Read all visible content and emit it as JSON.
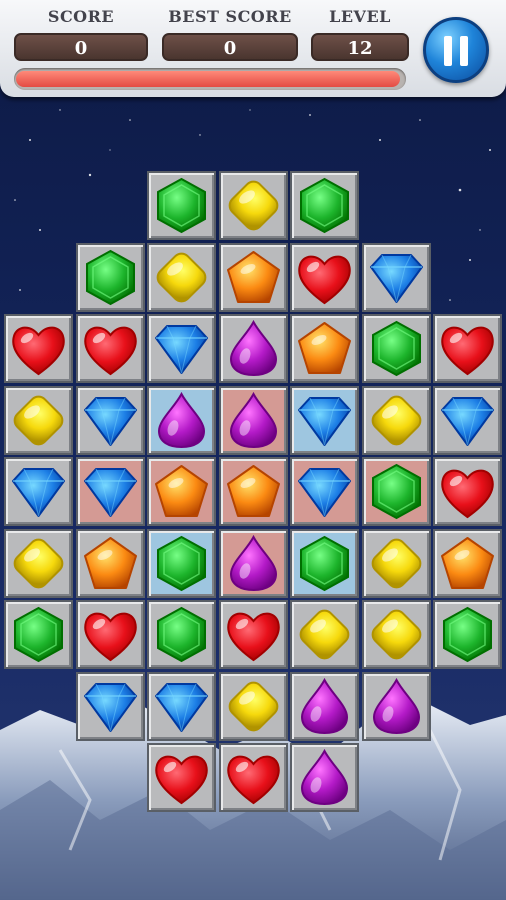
{
  "header": {
    "score_label": "SCORE",
    "score_value": "0",
    "best_label": "BEST SCORE",
    "best_value": "0",
    "level_label": "LEVEL",
    "level_value": "12",
    "progress_fraction": 0.99
  },
  "colors": {
    "green": "#1db52c",
    "yellow": "#f6d90c",
    "orange": "#fb8a12",
    "red": "#e8101a",
    "blue": "#1d7fe6",
    "purple": "#b41ac8",
    "highlight_blue": "#9ec6e0",
    "highlight_red": "#d49a94"
  },
  "board": {
    "rows": [
      [
        null,
        null,
        {
          "gem": "green"
        },
        {
          "gem": "yellow"
        },
        {
          "gem": "green"
        },
        null,
        null
      ],
      [
        null,
        {
          "gem": "green"
        },
        {
          "gem": "yellow"
        },
        {
          "gem": "orange"
        },
        {
          "gem": "red"
        },
        {
          "gem": "blue"
        },
        null
      ],
      [
        {
          "gem": "red"
        },
        {
          "gem": "red"
        },
        {
          "gem": "blue"
        },
        {
          "gem": "purple"
        },
        {
          "gem": "orange"
        },
        {
          "gem": "green"
        },
        {
          "gem": "red"
        }
      ],
      [
        {
          "gem": "yellow"
        },
        {
          "gem": "blue"
        },
        {
          "gem": "purple",
          "hl": "blue"
        },
        {
          "gem": "purple",
          "hl": "red"
        },
        {
          "gem": "blue",
          "hl": "blue"
        },
        {
          "gem": "yellow"
        },
        {
          "gem": "blue"
        }
      ],
      [
        {
          "gem": "blue"
        },
        {
          "gem": "blue",
          "hl": "red"
        },
        {
          "gem": "orange",
          "hl": "red"
        },
        {
          "gem": "orange",
          "hl": "red"
        },
        {
          "gem": "blue",
          "hl": "red"
        },
        {
          "gem": "green",
          "hl": "red"
        },
        {
          "gem": "red"
        }
      ],
      [
        {
          "gem": "yellow"
        },
        {
          "gem": "orange"
        },
        {
          "gem": "green",
          "hl": "blue"
        },
        {
          "gem": "purple",
          "hl": "red"
        },
        {
          "gem": "green",
          "hl": "blue"
        },
        {
          "gem": "yellow"
        },
        {
          "gem": "orange"
        }
      ],
      [
        {
          "gem": "green"
        },
        {
          "gem": "red"
        },
        {
          "gem": "green"
        },
        {
          "gem": "red"
        },
        {
          "gem": "yellow"
        },
        {
          "gem": "yellow"
        },
        {
          "gem": "green"
        }
      ],
      [
        null,
        {
          "gem": "blue"
        },
        {
          "gem": "blue"
        },
        {
          "gem": "yellow"
        },
        {
          "gem": "purple"
        },
        {
          "gem": "purple"
        },
        null
      ],
      [
        null,
        null,
        {
          "gem": "red"
        },
        {
          "gem": "red"
        },
        {
          "gem": "purple"
        },
        null,
        null
      ]
    ]
  }
}
